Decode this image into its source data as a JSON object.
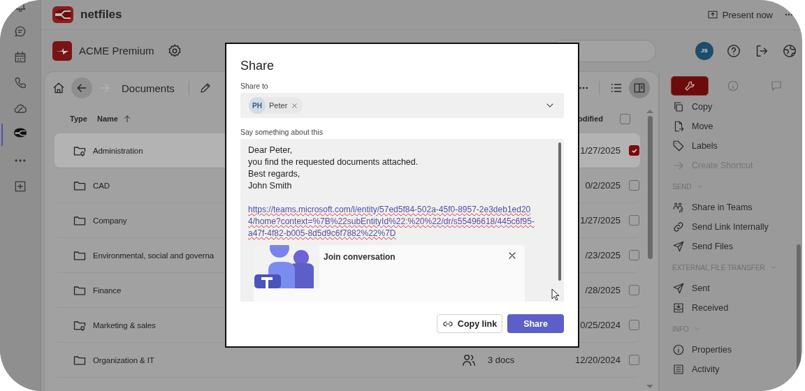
{
  "rail": {
    "items": [
      {
        "kind": "bell",
        "selected": false
      },
      {
        "kind": "chat",
        "selected": false
      },
      {
        "kind": "calendar",
        "selected": false
      },
      {
        "kind": "phone",
        "selected": false
      },
      {
        "kind": "cloud",
        "selected": false
      },
      {
        "kind": "app",
        "selected": true
      },
      {
        "kind": "dots",
        "selected": false
      },
      {
        "kind": "plus",
        "selected": false
      }
    ]
  },
  "top_bar": {
    "brand": "netfiles",
    "present_button": "Present now"
  },
  "workspace": {
    "name": "ACME Premium"
  },
  "user": {
    "initials": "JS"
  },
  "documents": {
    "breadcrumb": "Documents",
    "columns": [
      "Type",
      "Name",
      "odified"
    ],
    "select_all_checked": false,
    "rows": [
      {
        "kind": "shared_folder",
        "name": "Administration",
        "modified": "1/27/2025",
        "selected": true,
        "checked": true
      },
      {
        "kind": "folder",
        "name": "CAD",
        "modified": "0/2/2025",
        "selected": false,
        "checked": false
      },
      {
        "kind": "folder",
        "name": "Company",
        "modified": "1/27/2025",
        "selected": false,
        "checked": false
      },
      {
        "kind": "folder",
        "name": "Environmental, social and governa",
        "modified": "/23/2025",
        "selected": false,
        "checked": false
      },
      {
        "kind": "folder",
        "name": "Finance",
        "modified": "/28/2025",
        "selected": false,
        "checked": false
      },
      {
        "kind": "shared_folder",
        "name": "Marketing & sales",
        "modified": "0/25/2024",
        "selected": false,
        "checked": false
      },
      {
        "kind": "folder",
        "name": "Organization & IT",
        "members": true,
        "column_4": "3 docs",
        "modified": "12/20/2024",
        "selected": false,
        "checked": false
      }
    ]
  },
  "side_panel": {
    "tabs": [
      {
        "kind": "tools",
        "selected": true
      },
      {
        "kind": "info",
        "selected": false
      },
      {
        "kind": "comments",
        "selected": false
      }
    ],
    "sections": [
      {
        "items": [
          {
            "kind": "copy",
            "label": "Copy",
            "disabled": false
          },
          {
            "kind": "move",
            "label": "Move",
            "disabled": false
          },
          {
            "kind": "tag",
            "label": "Labels",
            "disabled": false
          },
          {
            "kind": "arrow",
            "label": "Create Shortcut",
            "disabled": true
          }
        ]
      },
      {
        "title": "SEND",
        "items": [
          {
            "kind": "teams",
            "label": "Share in Teams",
            "disabled": false
          },
          {
            "kind": "link",
            "label": "Send Link Internally",
            "disabled": false
          },
          {
            "kind": "send",
            "label": "Send Files",
            "disabled": false
          }
        ]
      },
      {
        "title": "EXTERNAL FILE TRANSFER",
        "items": [
          {
            "kind": "send",
            "label": "Sent",
            "disabled": false
          },
          {
            "kind": "inbox",
            "label": "Received",
            "disabled": false
          }
        ]
      },
      {
        "title": "INFO",
        "items": [
          {
            "kind": "info",
            "label": "Properties",
            "disabled": false
          },
          {
            "kind": "activity",
            "label": "Activity",
            "disabled": false
          }
        ]
      }
    ]
  },
  "dialog": {
    "title": "Share",
    "share_to_label": "Share to",
    "recipients": [
      {
        "initials": "PH",
        "name": "Peter"
      }
    ],
    "message_label": "Say something about this",
    "message_lines": [
      "Dear Peter,",
      "you find the requested documents attached.",
      "Best regards,",
      "John Smith"
    ],
    "link": "https://teams.microsoft.com/l/entity/57ed5f84-502a-45f0-8957-2e3deb1ed204/home?context=%7B%22subEntityId%22:%20%22/dr/s55496618/445c6f95-a47f-4f82-b005-8d5d9c6f7882%22%7D",
    "card_title": "Join conversation",
    "copy_link_button": "Copy link",
    "share_button": "Share"
  }
}
